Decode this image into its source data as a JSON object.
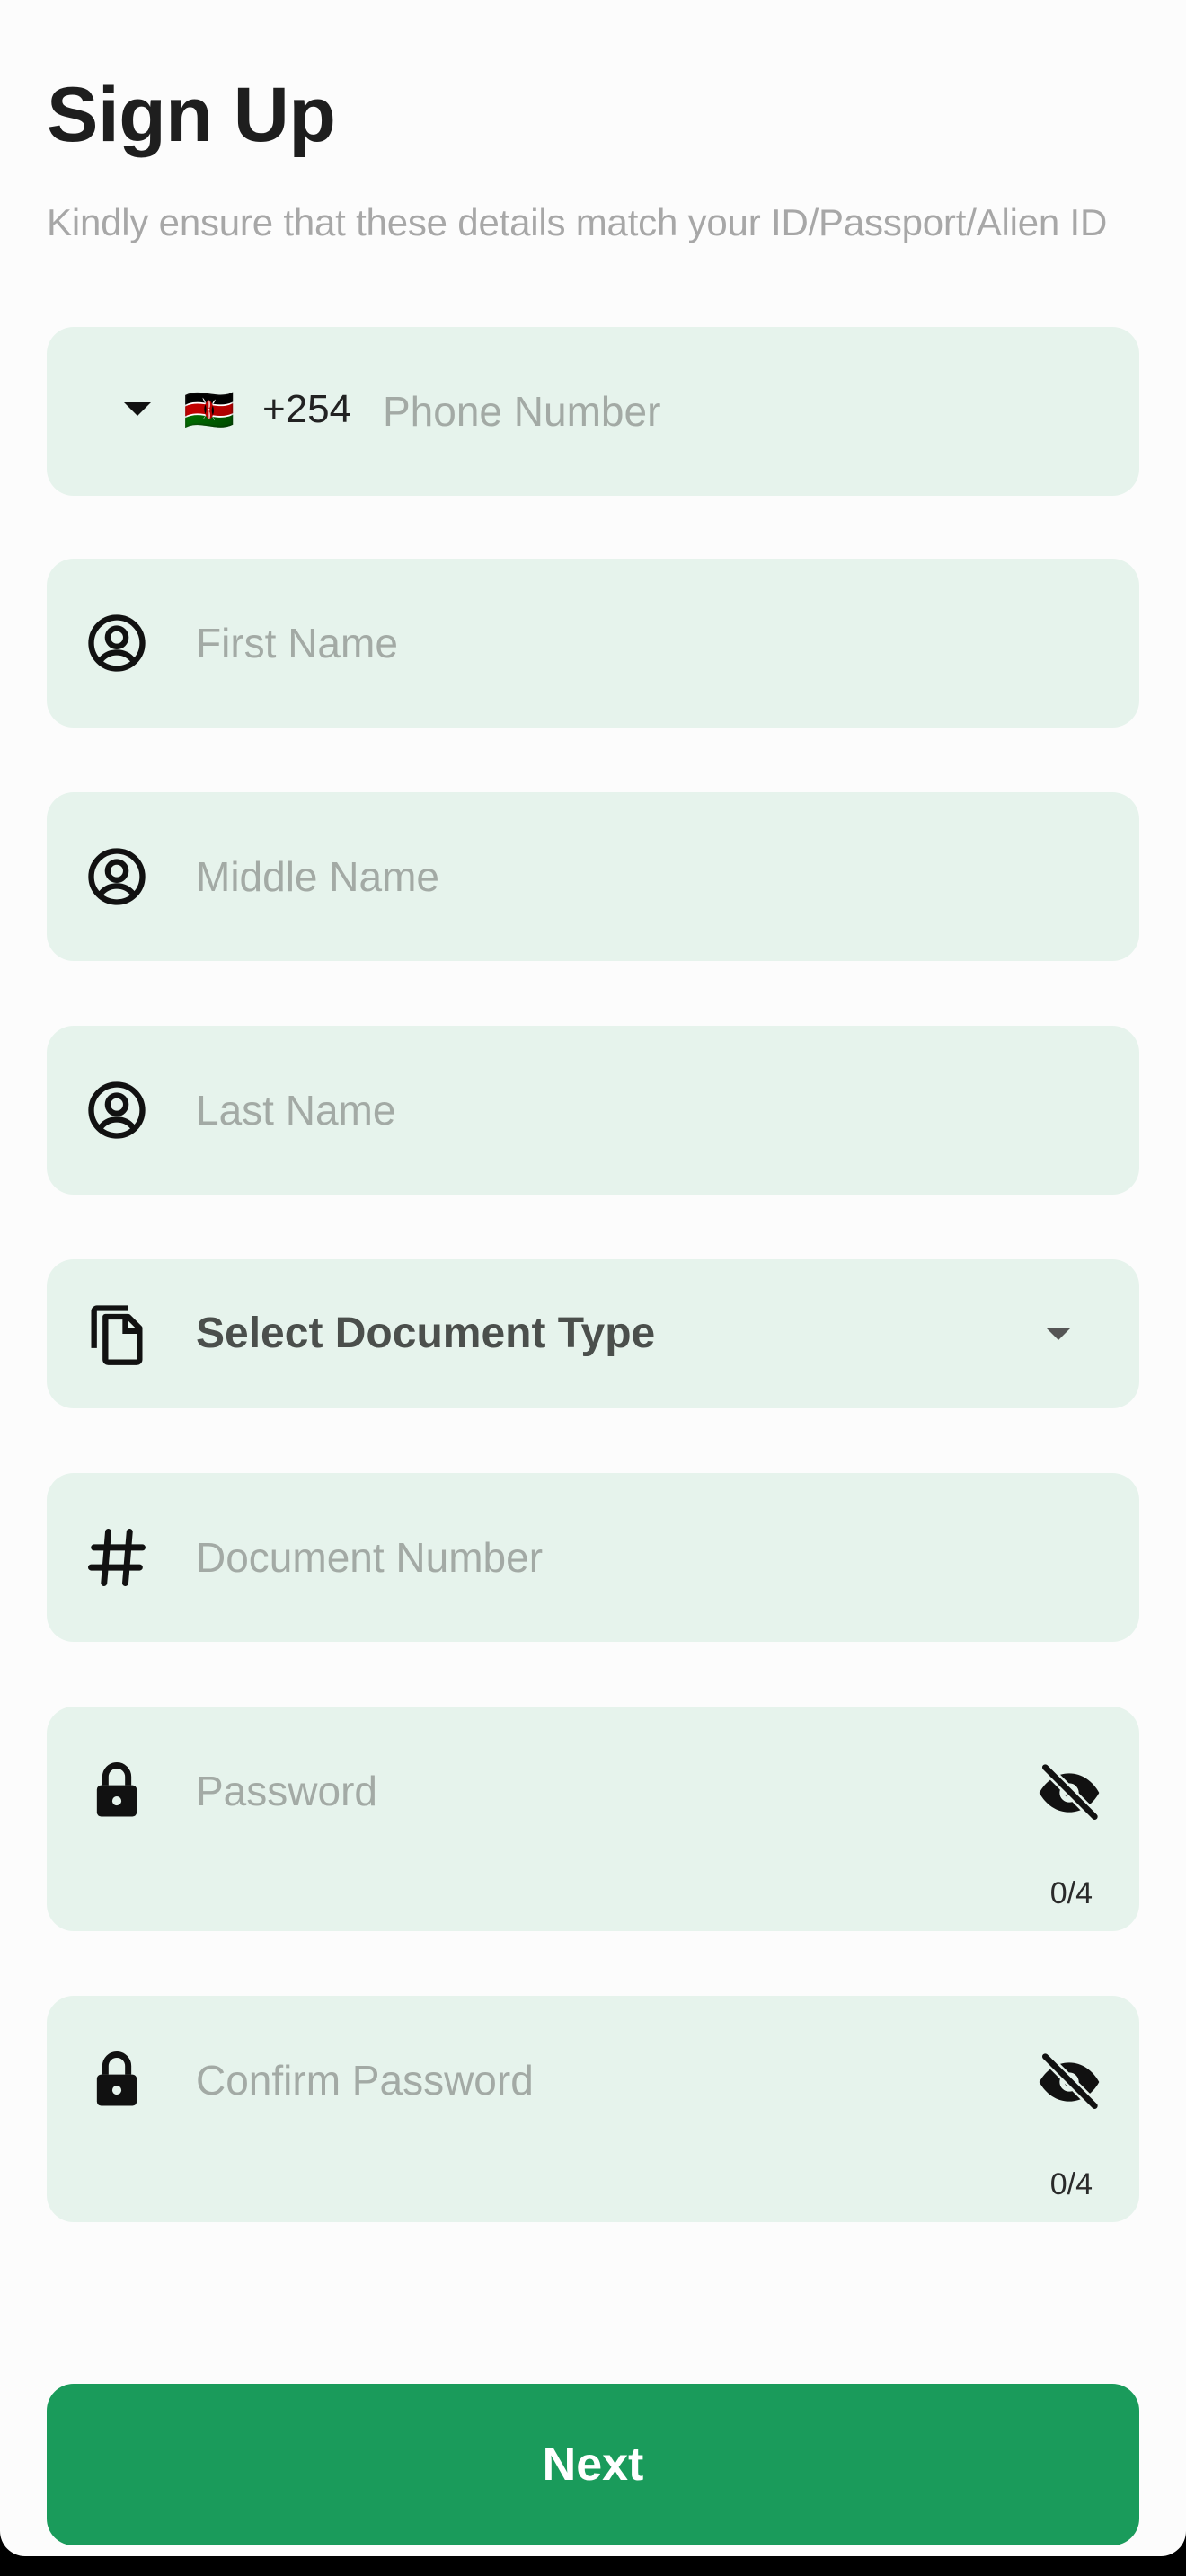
{
  "header": {
    "title": "Sign Up",
    "subtitle": "Kindly ensure that these details match your ID/Passport/Alien ID"
  },
  "phone": {
    "country_code": "+254",
    "flag": "🇰🇪",
    "placeholder": "Phone Number",
    "dropdown_icon": "caret-down-icon"
  },
  "fields": {
    "first_name": {
      "placeholder": "First Name",
      "icon": "account-circle-icon"
    },
    "middle_name": {
      "placeholder": "Middle Name",
      "icon": "account-circle-icon"
    },
    "last_name": {
      "placeholder": "Last Name",
      "icon": "account-circle-icon"
    },
    "document_type": {
      "label": "Select Document Type",
      "icon": "file-copy-icon",
      "dropdown_icon": "caret-down-icon"
    },
    "document_number": {
      "placeholder": "Document Number",
      "icon": "hash-icon"
    },
    "password": {
      "placeholder": "Password",
      "counter": "0/4",
      "icon": "lock-icon",
      "toggle_icon": "eye-off-icon"
    },
    "confirm_password": {
      "placeholder": "Confirm Password",
      "counter": "0/4",
      "icon": "lock-icon",
      "toggle_icon": "eye-off-icon"
    }
  },
  "actions": {
    "next_label": "Next"
  },
  "colors": {
    "field_bg": "#e6f3ec",
    "primary": "#1a9b5b",
    "title": "#1e1e1e",
    "placeholder": "#a3aaa5"
  }
}
